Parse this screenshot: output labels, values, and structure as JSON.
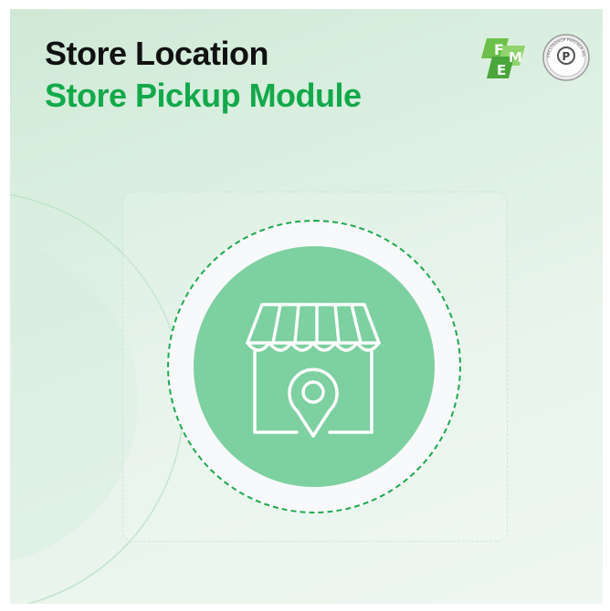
{
  "title": {
    "line1": "Store Location",
    "line2": "Store Pickup Module"
  },
  "logos": {
    "fme_letters": [
      "F",
      "M",
      "E"
    ],
    "agency_badge_text": "PRESTASHOP PARTNER AGENCY"
  },
  "colors": {
    "title_dark": "#111111",
    "title_green": "#12a94a",
    "disc_green": "#7dd0a0",
    "ring_dash": "#1eaa4e",
    "background_mint": "#dcefe2"
  },
  "icons": {
    "center": "store-pin-icon"
  }
}
